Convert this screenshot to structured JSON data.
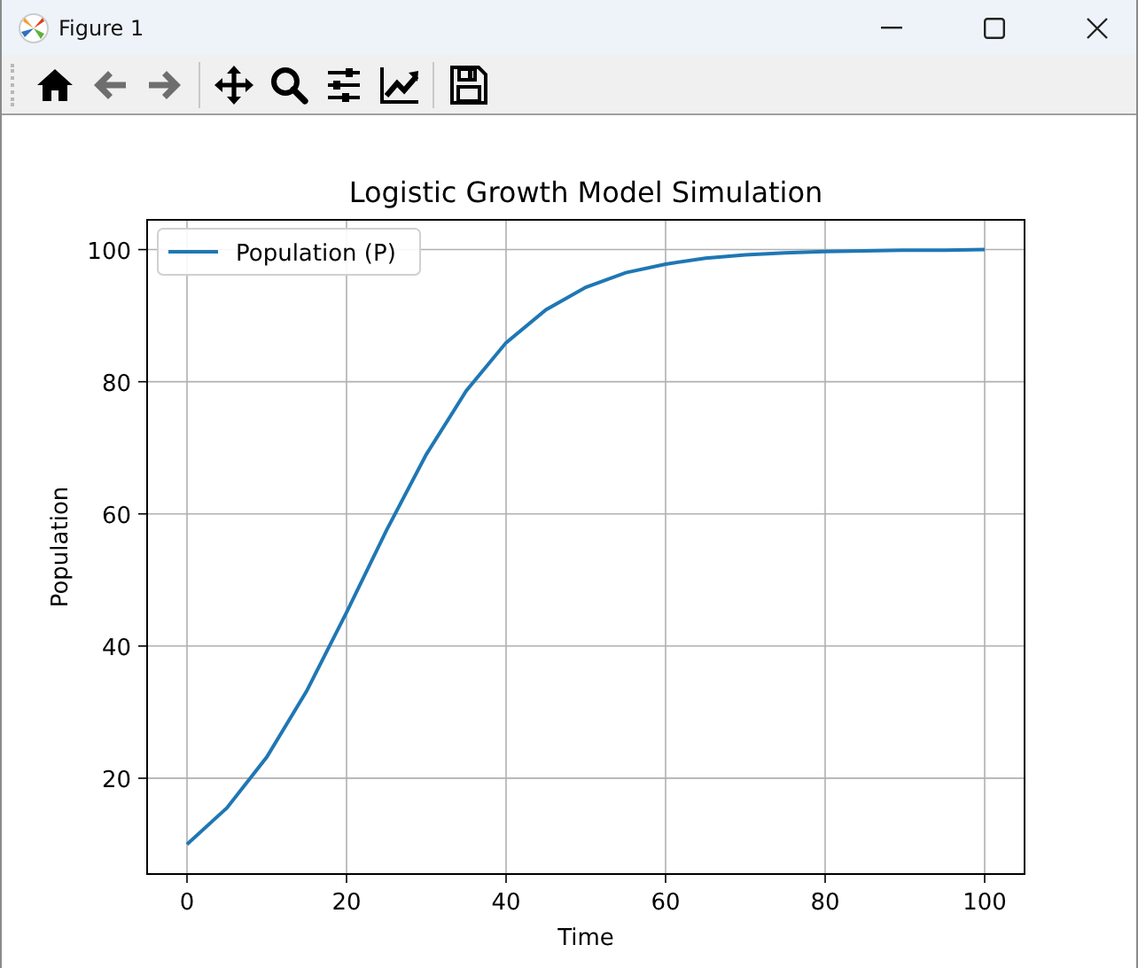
{
  "window": {
    "title": "Figure 1"
  },
  "toolbar": [
    [
      {
        "kind": "home",
        "disabled": false
      },
      {
        "kind": "back",
        "disabled": true
      },
      {
        "kind": "forward",
        "disabled": true
      }
    ],
    [
      {
        "kind": "move",
        "disabled": false
      },
      {
        "kind": "zoom",
        "disabled": false
      },
      {
        "kind": "subplots",
        "disabled": false
      },
      {
        "kind": "axes",
        "disabled": false
      }
    ],
    [
      {
        "kind": "save",
        "disabled": false
      }
    ]
  ],
  "figure": {
    "chart_data": {
      "type": "line",
      "title": "Logistic Growth Model Simulation",
      "xlabel": "Time",
      "ylabel": "Population",
      "x": [
        0,
        5,
        10,
        15,
        20,
        25,
        30,
        35,
        40,
        45,
        50,
        55,
        60,
        65,
        70,
        75,
        80,
        85,
        90,
        95,
        100
      ],
      "series": [
        {
          "name": "Population (P)",
          "color": "#1f77b4",
          "values": [
            10,
            15.5,
            23.2,
            33.2,
            45.1,
            57.5,
            69,
            78.6,
            85.9,
            90.9,
            94.3,
            96.5,
            97.8,
            98.7,
            99.2,
            99.5,
            99.7,
            99.8,
            99.9,
            99.9,
            100
          ]
        }
      ],
      "grid": true,
      "xlim": [
        -5,
        105
      ],
      "ylim": [
        5.5,
        104.5
      ],
      "xticks": [
        0,
        20,
        40,
        60,
        80,
        100
      ],
      "yticks": [
        20,
        40,
        60,
        80,
        100
      ]
    }
  }
}
